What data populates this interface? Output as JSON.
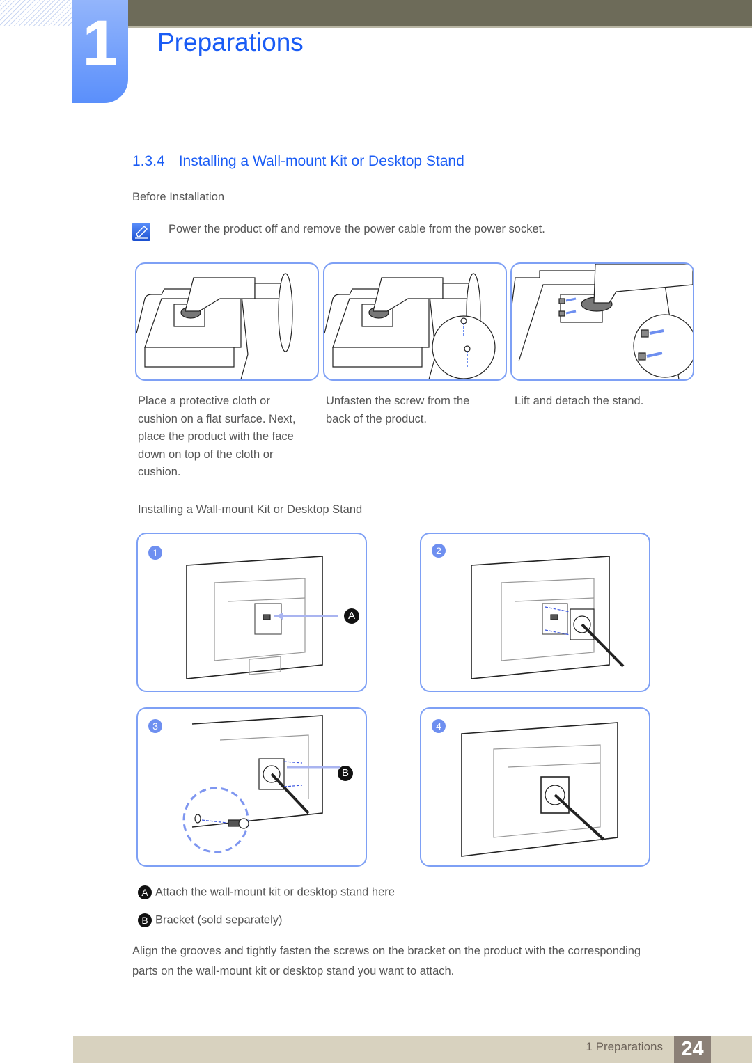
{
  "header": {
    "chapter_number": "1",
    "chapter_title": "Preparations"
  },
  "section": {
    "number": "1.3.4",
    "title": "Installing a Wall-mount Kit or Desktop Stand"
  },
  "before_installation": {
    "heading": "Before Installation",
    "note_icon": "note-pen-icon",
    "note": "Power the product off and remove the power cable from the power socket.",
    "steps": [
      {
        "caption": [
          "Place a protective cloth or",
          "cushion on a flat surface. Next,",
          "place the product with the face",
          "down on top of the cloth or",
          "cushion."
        ]
      },
      {
        "caption": [
          "Unfasten the screw from the",
          "back of the product."
        ]
      },
      {
        "caption": [
          "Lift and detach the stand."
        ]
      }
    ]
  },
  "installing": {
    "heading": "Installing a Wall-mount Kit or Desktop Stand",
    "steps": [
      {
        "badge": "1",
        "callout": "A"
      },
      {
        "badge": "2",
        "callout": ""
      },
      {
        "badge": "3",
        "callout": "B"
      },
      {
        "badge": "4",
        "callout": ""
      }
    ],
    "legend": [
      {
        "letter": "A",
        "text": "Attach the wall-mount kit or desktop stand here"
      },
      {
        "letter": "B",
        "text": "Bracket (sold separately)"
      }
    ],
    "instruction": [
      "Align the grooves and tightly fasten the screws on the bracket on the product with the corresponding",
      "parts on the wall-mount kit or desktop stand you want to attach."
    ]
  },
  "footer": {
    "label": "1 Preparations",
    "page": "24"
  },
  "colors": {
    "accent_blue": "#1a5cf5",
    "panel_border": "#7ea0f5",
    "top_bar": "#6d6b59",
    "footer_bar": "#d8d2bf",
    "page_box": "#8b8077"
  }
}
